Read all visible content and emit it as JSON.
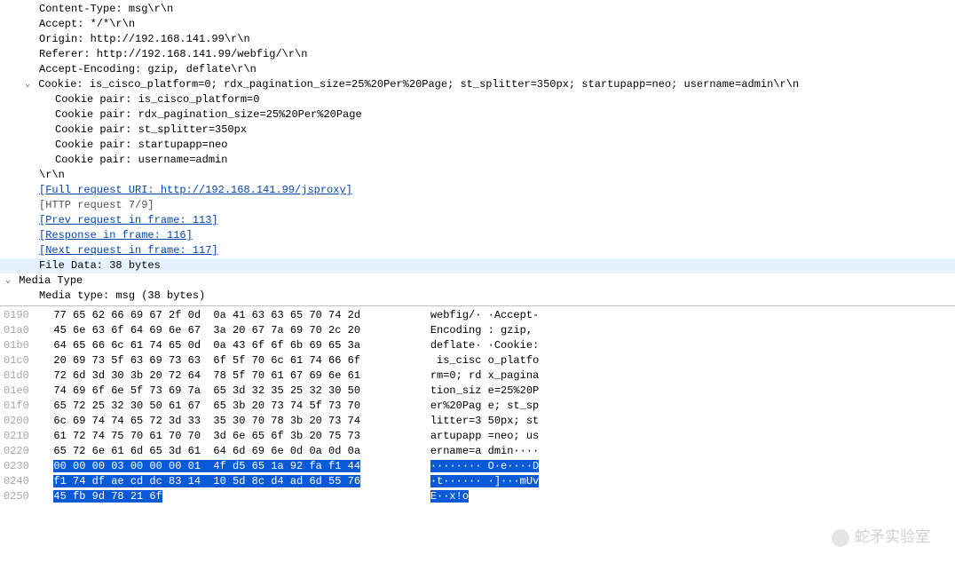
{
  "details": {
    "content_type": "Content-Type: msg\\r\\n",
    "accept": "Accept: */*\\r\\n",
    "origin": "Origin: http://192.168.141.99\\r\\n",
    "referer": "Referer: http://192.168.141.99/webfig/\\r\\n",
    "accept_encoding": "Accept-Encoding: gzip, deflate\\r\\n",
    "cookie_header": "Cookie: is_cisco_platform=0; rdx_pagination_size=25%20Per%20Page; st_splitter=350px; startupapp=neo; username=admin\\r\\n",
    "cookie_pairs": [
      "Cookie pair: is_cisco_platform=0",
      "Cookie pair: rdx_pagination_size=25%20Per%20Page",
      "Cookie pair: st_splitter=350px",
      "Cookie pair: startupapp=neo",
      "Cookie pair: username=admin"
    ],
    "crlf": "\\r\\n",
    "full_request_uri": "[Full request URI: http://192.168.141.99/jsproxy]",
    "http_request": "[HTTP request 7/9]",
    "prev_request": "[Prev request in frame: 113]",
    "response_in": "[Response in frame: 116]",
    "next_request": "[Next request in frame: 117]",
    "file_data": "File Data: 38 bytes",
    "media_type_header": "Media Type",
    "media_type_value": "Media type: msg (38 bytes)"
  },
  "hex": [
    {
      "off": "0190",
      "b": "77 65 62 66 69 67 2f 0d  0a 41 63 63 65 70 74 2d",
      "a": "webfig/· ·Accept-",
      "sel": false
    },
    {
      "off": "01a0",
      "b": "45 6e 63 6f 64 69 6e 67  3a 20 67 7a 69 70 2c 20",
      "a": "Encoding : gzip, ",
      "sel": false
    },
    {
      "off": "01b0",
      "b": "64 65 66 6c 61 74 65 0d  0a 43 6f 6f 6b 69 65 3a",
      "a": "deflate· ·Cookie:",
      "sel": false
    },
    {
      "off": "01c0",
      "b": "20 69 73 5f 63 69 73 63  6f 5f 70 6c 61 74 66 6f",
      "a": " is_cisc o_platfo",
      "sel": false
    },
    {
      "off": "01d0",
      "b": "72 6d 3d 30 3b 20 72 64  78 5f 70 61 67 69 6e 61",
      "a": "rm=0; rd x_pagina",
      "sel": false
    },
    {
      "off": "01e0",
      "b": "74 69 6f 6e 5f 73 69 7a  65 3d 32 35 25 32 30 50",
      "a": "tion_siz e=25%20P",
      "sel": false
    },
    {
      "off": "01f0",
      "b": "65 72 25 32 30 50 61 67  65 3b 20 73 74 5f 73 70",
      "a": "er%20Pag e; st_sp",
      "sel": false
    },
    {
      "off": "0200",
      "b": "6c 69 74 74 65 72 3d 33  35 30 70 78 3b 20 73 74",
      "a": "litter=3 50px; st",
      "sel": false
    },
    {
      "off": "0210",
      "b": "61 72 74 75 70 61 70 70  3d 6e 65 6f 3b 20 75 73",
      "a": "artupapp =neo; us",
      "sel": false
    },
    {
      "off": "0220",
      "b": "65 72 6e 61 6d 65 3d 61  64 6d 69 6e 0d 0a 0d 0a",
      "a": "ername=a dmin····",
      "sel": false
    },
    {
      "off": "0230",
      "b": "00 00 00 03 00 00 00 01  4f d5 65 1a 92 fa f1 44",
      "a": "········ O·e····D",
      "sel": true
    },
    {
      "off": "0240",
      "b": "f1 74 df ae cd dc 83 14  10 5d 8c d4 ad 6d 55 76",
      "a": "·t······ ·]···mUv",
      "sel": true
    },
    {
      "off": "0250",
      "b": "45 fb 9d 78 21 6f",
      "a": "E··x!o",
      "sel": true
    }
  ],
  "watermark": "蛇矛实验室"
}
